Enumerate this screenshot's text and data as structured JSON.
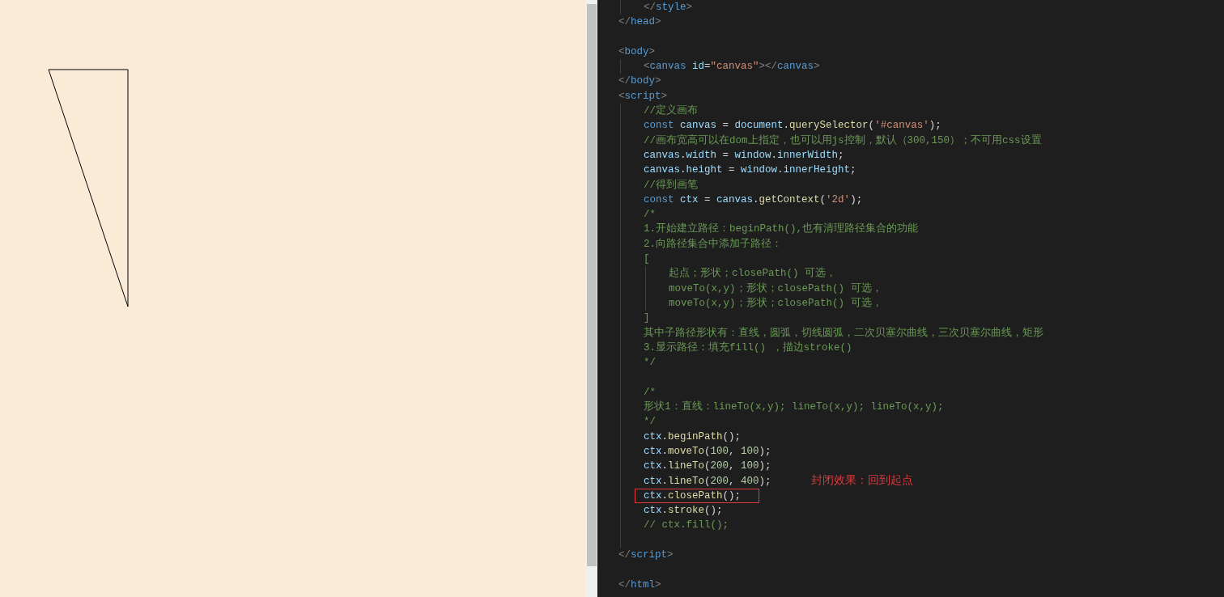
{
  "preview": {
    "kind": "canvas"
  },
  "editor": {
    "lines": [
      {
        "boxed": false,
        "children": [
          {
            "boxed": false,
            "tokens": [
              {
                "kind": "punct",
                "text": "</"
              },
              {
                "kind": "tag",
                "text": "style"
              },
              {
                "kind": "punct",
                "text": ">"
              }
            ]
          }
        ]
      },
      {
        "boxed": false,
        "tokens": [
          {
            "kind": "punct",
            "text": "</"
          },
          {
            "kind": "tag",
            "text": "head"
          },
          {
            "kind": "punct",
            "text": ">"
          }
        ]
      },
      {
        "boxed": false
      },
      {
        "boxed": false,
        "tokens": [
          {
            "kind": "punct",
            "text": "<"
          },
          {
            "kind": "tag",
            "text": "body"
          },
          {
            "kind": "punct",
            "text": ">"
          }
        ],
        "children": [
          {
            "boxed": false,
            "tokens": [
              {
                "kind": "punct",
                "text": "<"
              },
              {
                "kind": "tag",
                "text": "canvas"
              },
              {
                "kind": "attr",
                "text": " id"
              },
              {
                "kind": "plain",
                "text": "="
              },
              {
                "kind": "string",
                "text": "\"canvas\""
              },
              {
                "kind": "punct",
                "text": "></"
              },
              {
                "kind": "tag",
                "text": "canvas"
              },
              {
                "kind": "punct",
                "text": ">"
              }
            ]
          }
        ]
      },
      {
        "boxed": false,
        "tokens": [
          {
            "kind": "punct",
            "text": "</"
          },
          {
            "kind": "tag",
            "text": "body"
          },
          {
            "kind": "punct",
            "text": ">"
          }
        ]
      },
      {
        "boxed": false,
        "tokens": [
          {
            "kind": "punct",
            "text": "<"
          },
          {
            "kind": "tag",
            "text": "script"
          },
          {
            "kind": "punct",
            "text": ">"
          }
        ],
        "children": [
          {
            "boxed": false,
            "tokens": [
              {
                "kind": "comment",
                "text": "//定义画布"
              }
            ]
          },
          {
            "boxed": false,
            "tokens": [
              {
                "kind": "keyword",
                "text": "const "
              },
              {
                "kind": "variable",
                "text": "canvas"
              },
              {
                "kind": "plain",
                "text": " = "
              },
              {
                "kind": "variable",
                "text": "document"
              },
              {
                "kind": "plain",
                "text": "."
              },
              {
                "kind": "func",
                "text": "querySelector"
              },
              {
                "kind": "plain",
                "text": "("
              },
              {
                "kind": "string",
                "text": "'#canvas'"
              },
              {
                "kind": "plain",
                "text": ");"
              }
            ]
          },
          {
            "boxed": false,
            "tokens": [
              {
                "kind": "comment",
                "text": "//画布宽高可以在dom上指定，也可以用js控制，默认（300,150）；不可用css设置"
              }
            ]
          },
          {
            "boxed": false,
            "tokens": [
              {
                "kind": "variable",
                "text": "canvas"
              },
              {
                "kind": "plain",
                "text": "."
              },
              {
                "kind": "variable",
                "text": "width"
              },
              {
                "kind": "plain",
                "text": " = "
              },
              {
                "kind": "variable",
                "text": "window"
              },
              {
                "kind": "plain",
                "text": "."
              },
              {
                "kind": "variable",
                "text": "innerWidth"
              },
              {
                "kind": "plain",
                "text": ";"
              }
            ]
          },
          {
            "boxed": false,
            "tokens": [
              {
                "kind": "variable",
                "text": "canvas"
              },
              {
                "kind": "plain",
                "text": "."
              },
              {
                "kind": "variable",
                "text": "height"
              },
              {
                "kind": "plain",
                "text": " = "
              },
              {
                "kind": "variable",
                "text": "window"
              },
              {
                "kind": "plain",
                "text": "."
              },
              {
                "kind": "variable",
                "text": "innerHeight"
              },
              {
                "kind": "plain",
                "text": ";"
              }
            ]
          },
          {
            "boxed": false,
            "tokens": [
              {
                "kind": "comment",
                "text": "//得到画笔"
              }
            ]
          },
          {
            "boxed": false,
            "tokens": [
              {
                "kind": "keyword",
                "text": "const "
              },
              {
                "kind": "variable",
                "text": "ctx"
              },
              {
                "kind": "plain",
                "text": " = "
              },
              {
                "kind": "variable",
                "text": "canvas"
              },
              {
                "kind": "plain",
                "text": "."
              },
              {
                "kind": "func",
                "text": "getContext"
              },
              {
                "kind": "plain",
                "text": "("
              },
              {
                "kind": "string",
                "text": "'2d'"
              },
              {
                "kind": "plain",
                "text": ");"
              }
            ]
          },
          {
            "boxed": false,
            "tokens": [
              {
                "kind": "comment",
                "text": "/*"
              }
            ]
          },
          {
            "boxed": false,
            "tokens": [
              {
                "kind": "comment",
                "text": "1.开始建立路径：beginPath(),也有清理路径集合的功能"
              }
            ]
          },
          {
            "boxed": false,
            "tokens": [
              {
                "kind": "comment",
                "text": "2.向路径集合中添加子路径："
              }
            ]
          },
          {
            "boxed": false,
            "tokens": [
              {
                "kind": "comment",
                "text": "["
              }
            ],
            "children": [
              {
                "boxed": false,
                "tokens": [
                  {
                    "kind": "comment",
                    "text": "起点；形状；closePath() 可选，"
                  }
                ]
              },
              {
                "boxed": false,
                "tokens": [
                  {
                    "kind": "comment",
                    "text": "moveTo(x,y)；形状；closePath() 可选，"
                  }
                ]
              },
              {
                "boxed": false,
                "tokens": [
                  {
                    "kind": "comment",
                    "text": "moveTo(x,y)；形状；closePath() 可选，"
                  }
                ]
              }
            ]
          },
          {
            "boxed": false,
            "tokens": [
              {
                "kind": "comment",
                "text": "]"
              }
            ]
          },
          {
            "boxed": false,
            "tokens": [
              {
                "kind": "comment",
                "text": "其中子路径形状有：直线，圆弧，切线圆弧，二次贝塞尔曲线，三次贝塞尔曲线，矩形"
              }
            ]
          },
          {
            "boxed": false,
            "tokens": [
              {
                "kind": "comment",
                "text": "3.显示路径：填充fill() ，描边stroke()"
              }
            ]
          },
          {
            "boxed": false,
            "tokens": [
              {
                "kind": "comment",
                "text": "*/"
              }
            ]
          },
          {
            "boxed": false
          },
          {
            "boxed": false,
            "tokens": [
              {
                "kind": "comment",
                "text": "/*"
              }
            ]
          },
          {
            "boxed": false,
            "tokens": [
              {
                "kind": "comment",
                "text": "形状1：直线：lineTo(x,y); lineTo(x,y); lineTo(x,y);"
              }
            ]
          },
          {
            "boxed": false,
            "tokens": [
              {
                "kind": "comment",
                "text": "*/"
              }
            ]
          },
          {
            "boxed": false,
            "tokens": [
              {
                "kind": "variable",
                "text": "ctx"
              },
              {
                "kind": "plain",
                "text": "."
              },
              {
                "kind": "func",
                "text": "beginPath"
              },
              {
                "kind": "plain",
                "text": "();"
              }
            ]
          },
          {
            "boxed": false,
            "tokens": [
              {
                "kind": "variable",
                "text": "ctx"
              },
              {
                "kind": "plain",
                "text": "."
              },
              {
                "kind": "func",
                "text": "moveTo"
              },
              {
                "kind": "plain",
                "text": "("
              },
              {
                "kind": "number",
                "text": "100"
              },
              {
                "kind": "plain",
                "text": ", "
              },
              {
                "kind": "number",
                "text": "100"
              },
              {
                "kind": "plain",
                "text": ");"
              }
            ]
          },
          {
            "boxed": false,
            "tokens": [
              {
                "kind": "variable",
                "text": "ctx"
              },
              {
                "kind": "plain",
                "text": "."
              },
              {
                "kind": "func",
                "text": "lineTo"
              },
              {
                "kind": "plain",
                "text": "("
              },
              {
                "kind": "number",
                "text": "200"
              },
              {
                "kind": "plain",
                "text": ", "
              },
              {
                "kind": "number",
                "text": "100"
              },
              {
                "kind": "plain",
                "text": ");"
              }
            ]
          },
          {
            "boxed": false,
            "tokens": [
              {
                "kind": "variable",
                "text": "ctx"
              },
              {
                "kind": "plain",
                "text": "."
              },
              {
                "kind": "func",
                "text": "lineTo"
              },
              {
                "kind": "plain",
                "text": "("
              },
              {
                "kind": "number",
                "text": "200"
              },
              {
                "kind": "plain",
                "text": ", "
              },
              {
                "kind": "number",
                "text": "400"
              },
              {
                "kind": "plain",
                "text": ");"
              }
            ]
          },
          {
            "boxed": true,
            "tokens": [
              {
                "kind": "variable",
                "text": "ctx"
              },
              {
                "kind": "plain",
                "text": "."
              },
              {
                "kind": "func",
                "text": "closePath"
              },
              {
                "kind": "plain",
                "text": "();"
              }
            ]
          },
          {
            "boxed": false,
            "tokens": [
              {
                "kind": "variable",
                "text": "ctx"
              },
              {
                "kind": "plain",
                "text": "."
              },
              {
                "kind": "func",
                "text": "stroke"
              },
              {
                "kind": "plain",
                "text": "();"
              }
            ]
          },
          {
            "boxed": false,
            "tokens": [
              {
                "kind": "comment",
                "text": "// ctx.fill();"
              }
            ]
          },
          {
            "boxed": false
          }
        ]
      },
      {
        "boxed": false,
        "tokens": [
          {
            "kind": "punct",
            "text": "</"
          },
          {
            "kind": "tag",
            "text": "script"
          },
          {
            "kind": "punct",
            "text": ">"
          }
        ]
      },
      {
        "boxed": false
      },
      {
        "boxed": false,
        "tokens": [
          {
            "kind": "punct",
            "text": "</"
          },
          {
            "kind": "tag",
            "text": "html"
          },
          {
            "kind": "punct",
            "text": ">"
          }
        ]
      }
    ],
    "annotation": {
      "text": "封闭效果：回到起点"
    }
  }
}
